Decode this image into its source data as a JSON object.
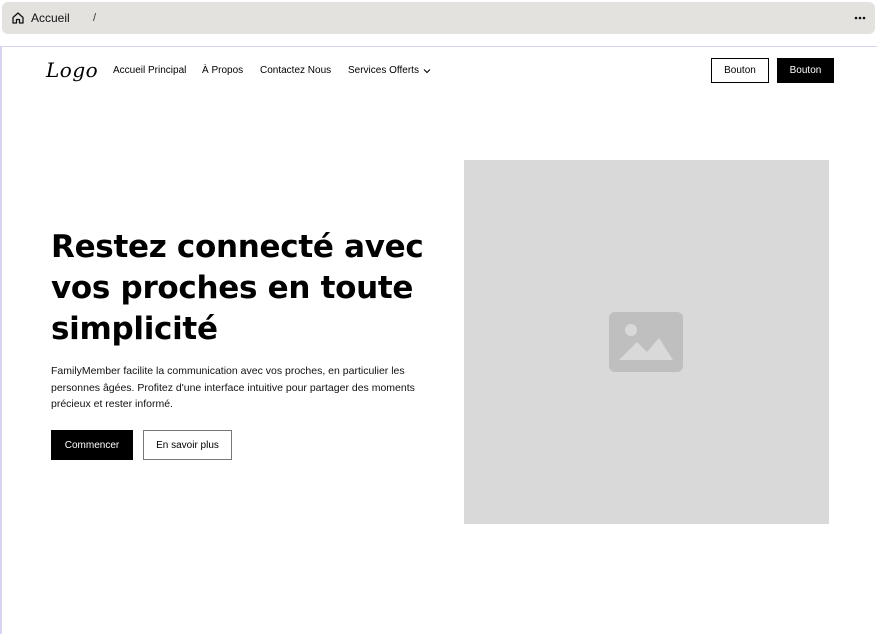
{
  "breadcrumb": {
    "home_label": "Accueil",
    "separator": "/"
  },
  "site": {
    "logo": "Logo",
    "nav": [
      {
        "label": "Accueil Principal"
      },
      {
        "label": "À Propos"
      },
      {
        "label": "Contactez Nous"
      },
      {
        "label": "Services Offerts"
      }
    ],
    "header_buttons": {
      "secondary": "Bouton",
      "primary": "Bouton"
    }
  },
  "hero": {
    "headline": "Restez connecté avec vos proches en toute simplicité",
    "description": "FamilyMember facilite la communication avec vos proches, en particulier les personnes âgées. Profitez d'une interface intuitive pour partager des moments précieux et rester informé.",
    "primary_cta": "Commencer",
    "secondary_cta": "En savoir plus",
    "image_placeholder_icon": "image-icon"
  },
  "colors": {
    "topbar": "#e3e2df",
    "placeholder": "#d9d9d9",
    "placeholder_icon": "#bfbfbf",
    "accent": "#000000"
  },
  "icons": {
    "home": "home-icon",
    "more": "more-horizontal-icon",
    "dropdown": "chevron-down-icon"
  }
}
